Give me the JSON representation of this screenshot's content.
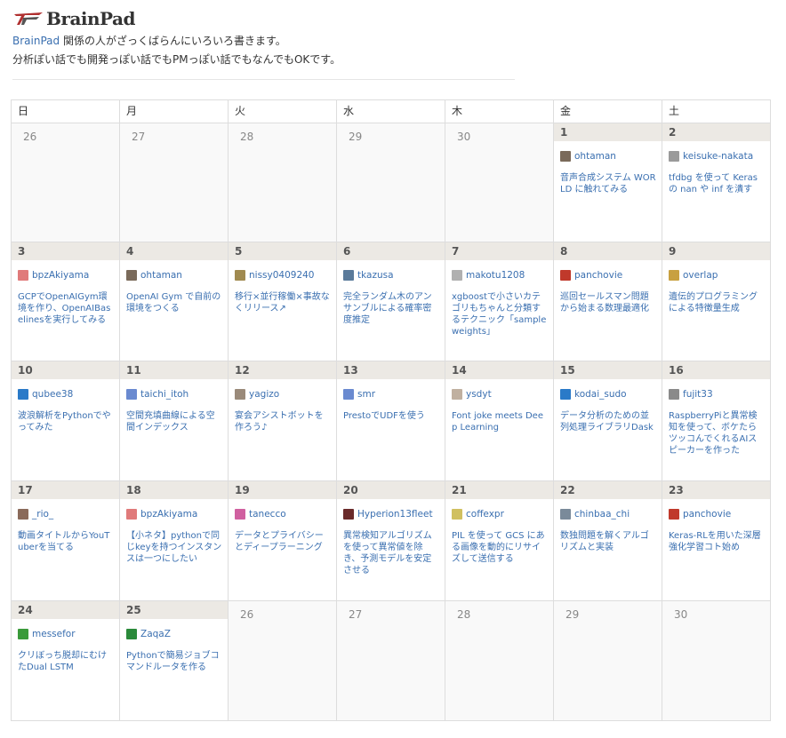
{
  "header": {
    "logo_text": "BrainPad",
    "desc_link": "BrainPad",
    "desc_line1_rest": " 関係の人がざっくばらんにいろいろ書きます。",
    "desc_line2": "分析ぽい話でも開発っぽい話でもPMっぽい話でもなんでもOKです。"
  },
  "calendar": {
    "weekdays": [
      "日",
      "月",
      "火",
      "水",
      "木",
      "金",
      "土"
    ],
    "weeks": [
      [
        {
          "other": true,
          "num": "26"
        },
        {
          "other": true,
          "num": "27"
        },
        {
          "other": true,
          "num": "28"
        },
        {
          "other": true,
          "num": "29"
        },
        {
          "other": true,
          "num": "30"
        },
        {
          "num": "1",
          "author": "ohtaman",
          "avatar_color": "#7a6a5a",
          "title": "音声合成システム WORLD に触れてみる"
        },
        {
          "num": "2",
          "author": "keisuke-nakata",
          "avatar_color": "#9a9a9a",
          "title": "tfdbg を使って Keras の nan や inf を潰す"
        }
      ],
      [
        {
          "num": "3",
          "author": "bpzAkiyama",
          "avatar_color": "#e07a7a",
          "title": "GCPでOpenAIGym環境を作り、OpenAIBaselinesを実行してみる"
        },
        {
          "num": "4",
          "author": "ohtaman",
          "avatar_color": "#7a6a5a",
          "title": "OpenAI Gym で自前の環境をつくる"
        },
        {
          "num": "5",
          "author": "nissy0409240",
          "avatar_color": "#a08a50",
          "title": "移行×並行稼働×事故なくリリース↗"
        },
        {
          "num": "6",
          "author": "tkazusa",
          "avatar_color": "#5a7a9a",
          "title": "完全ランダム木のアンサンブルによる確率密度推定"
        },
        {
          "num": "7",
          "author": "makotu1208",
          "avatar_color": "#b0b0b0",
          "title": "xgboostで小さいカテゴリもちゃんと分類するテクニック「sample weights」"
        },
        {
          "num": "8",
          "author": "panchovie",
          "avatar_color": "#c0392b",
          "title": "巡回セールスマン問題から始まる数理最適化"
        },
        {
          "num": "9",
          "author": "overlap",
          "avatar_color": "#c8a040",
          "title": "遺伝的プログラミングによる特徴量生成"
        }
      ],
      [
        {
          "num": "10",
          "author": "qubee38",
          "avatar_color": "#2a7ac8",
          "title": "波浪解析をPythonでやってみた"
        },
        {
          "num": "11",
          "author": "taichi_itoh",
          "avatar_color": "#6a8ad0",
          "title": "空間充填曲線による空間インデックス"
        },
        {
          "num": "12",
          "author": "yagizo",
          "avatar_color": "#9a8a7a",
          "title": "宴会アシストボットを作ろう♪"
        },
        {
          "num": "13",
          "author": "smr",
          "avatar_color": "#6a8ad0",
          "title": "PrestoでUDFを使う"
        },
        {
          "num": "14",
          "author": "ysdyt",
          "avatar_color": "#c0b0a0",
          "title": "Font joke meets Deep Learning"
        },
        {
          "num": "15",
          "author": "kodai_sudo",
          "avatar_color": "#2a7ac8",
          "title": "データ分析のための並列処理ライブラリDask"
        },
        {
          "num": "16",
          "author": "fujit33",
          "avatar_color": "#8a8a8a",
          "title": "RaspberryPiと異常検知を使って、ボケたらツッコんでくれるAIスピーカーを作った"
        }
      ],
      [
        {
          "num": "17",
          "author": "_rio_",
          "avatar_color": "#8a6a5a",
          "title": "動画タイトルからYouTuberを当てる"
        },
        {
          "num": "18",
          "author": "bpzAkiyama",
          "avatar_color": "#e07a7a",
          "title": "【小ネタ】pythonで同じkeyを持つインスタンスは一つにしたい"
        },
        {
          "num": "19",
          "author": "tanecco",
          "avatar_color": "#d060a0",
          "title": "データとプライバシーとディープラーニング"
        },
        {
          "num": "20",
          "author": "Hyperion13fleet",
          "avatar_color": "#6a2a2a",
          "title": "異常検知アルゴリズムを使って異常値を除き、予測モデルを安定させる"
        },
        {
          "num": "21",
          "author": "coffexpr",
          "avatar_color": "#d0c060",
          "title": "PIL を使って GCS にある画像を動的にリサイズして送信する"
        },
        {
          "num": "22",
          "author": "chinbaa_chi",
          "avatar_color": "#7a8a9a",
          "title": "数独問題を解くアルゴリズムと実装"
        },
        {
          "num": "23",
          "author": "panchovie",
          "avatar_color": "#c0392b",
          "title": "Keras-RLを用いた深層強化学習コト始め"
        }
      ],
      [
        {
          "num": "24",
          "author": "messefor",
          "avatar_color": "#3a9a3a",
          "title": "クリぼっち脱却にむけたDual LSTM"
        },
        {
          "num": "25",
          "author": "ZaqaZ",
          "avatar_color": "#2a8a3a",
          "title": "Pythonで簡易ジョブコマンドルータを作る"
        },
        {
          "other": true,
          "num": "26"
        },
        {
          "other": true,
          "num": "27"
        },
        {
          "other": true,
          "num": "28"
        },
        {
          "other": true,
          "num": "29"
        },
        {
          "other": true,
          "num": "30"
        }
      ]
    ]
  }
}
